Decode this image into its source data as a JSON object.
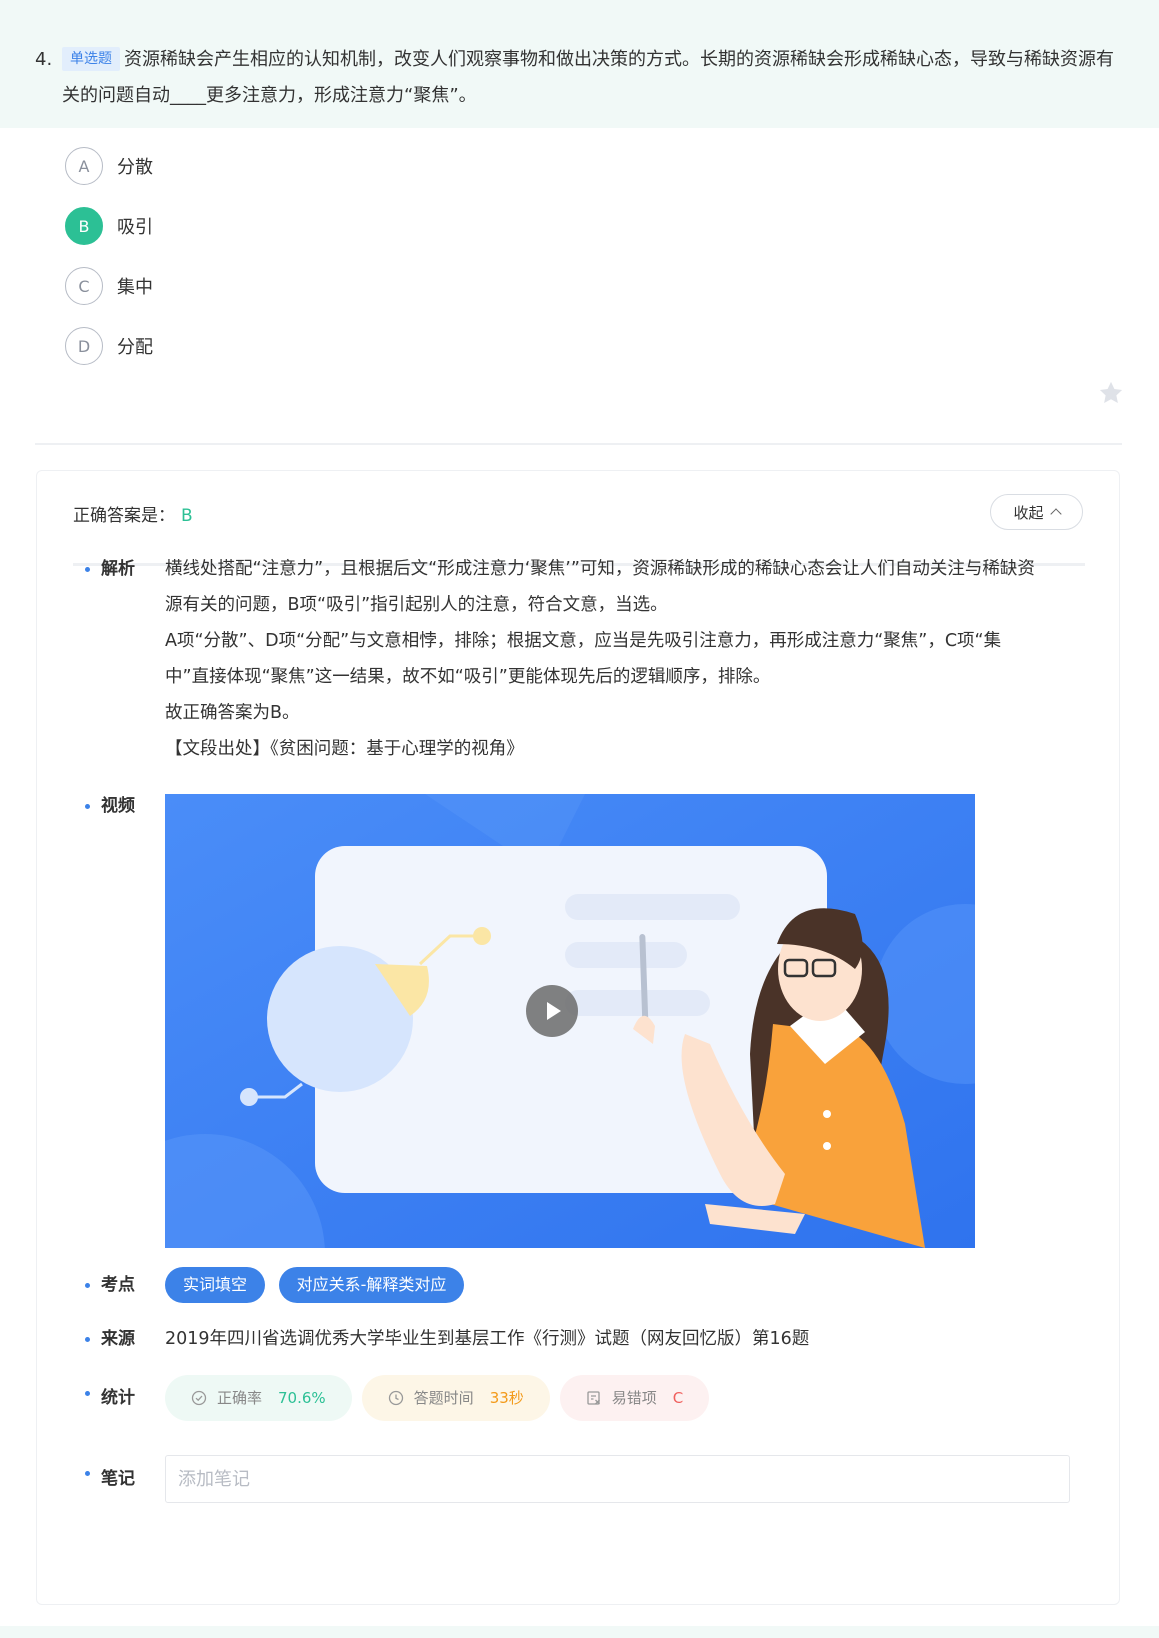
{
  "question": {
    "number": "4.",
    "type_badge": "单选题",
    "text": "资源稀缺会产生相应的认知机制，改变人们观察事物和做出决策的方式。长期的资源稀缺会形成稀缺心态，导致与稀缺资源有关的问题自动____更多注意力，形成注意力“聚焦”。"
  },
  "options": [
    {
      "letter": "A",
      "text": "分散",
      "selected": false
    },
    {
      "letter": "B",
      "text": "吸引",
      "selected": true
    },
    {
      "letter": "C",
      "text": "集中",
      "selected": false
    },
    {
      "letter": "D",
      "text": "分配",
      "selected": false
    }
  ],
  "answer_panel": {
    "correct_label": "正确答案是：",
    "correct_value": "B",
    "collapse_label": "收起"
  },
  "analysis": {
    "title": "解析",
    "paragraphs": [
      "横线处搭配“注意力”，且根据后文“形成注意力‘聚焦’”可知，资源稀缺形成的稀缺心态会让人们自动关注与稀缺资源有关的问题，B项“吸引”指引起别人的注意，符合文意，当选。",
      "A项“分散”、D项“分配”与文意相悖，排除；根据文意，应当是先吸引注意力，再形成注意力“聚焦”，C项“集中”直接体现“聚焦”这一结果，故不如“吸引”更能体现先后的逻辑顺序，排除。",
      "故正确答案为B。",
      "【文段出处】《贫困问题：基于心理学的视角》"
    ]
  },
  "video": {
    "title": "视频",
    "play_icon": "play-icon"
  },
  "keypoints": {
    "title": "考点",
    "tags": [
      "实词填空",
      "对应关系-解释类对应"
    ]
  },
  "source": {
    "title": "来源",
    "text": "2019年四川省选调优秀大学毕业生到基层工作《行测》试题（网友回忆版）第16题"
  },
  "stats": {
    "title": "统计",
    "accuracy_label": "正确率",
    "accuracy_value": "70.6%",
    "time_label": "答题时间",
    "time_value": "33秒",
    "wrong_label": "易错项",
    "wrong_value": "C"
  },
  "notes": {
    "title": "笔记",
    "placeholder": "添加笔记"
  },
  "colors": {
    "accent_blue": "#3c82e8",
    "correct_green": "#2cc095",
    "header_bg": "#f1f9f7",
    "video_bg": "#3d82f6"
  }
}
